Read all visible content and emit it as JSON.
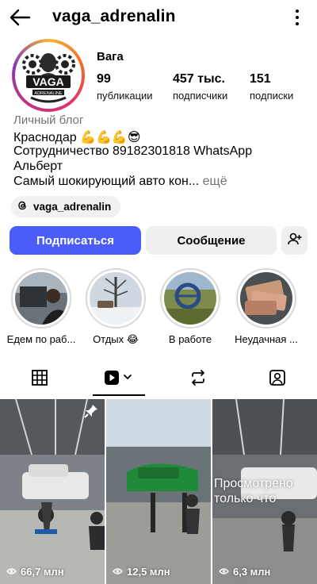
{
  "header": {
    "username": "vaga_adrenalin"
  },
  "profile": {
    "name": "Вага",
    "avatar_text": "VAGA",
    "avatar_subtext": "ADRENALINE",
    "stats": [
      {
        "value": "99",
        "label": "публикации"
      },
      {
        "value": "457 тыс.",
        "label": "подписчики"
      },
      {
        "value": "151",
        "label": "подписки"
      }
    ],
    "category": "Личный блог",
    "bio": [
      "Краснодар 💪💪💪😎",
      "Сотрудничество 89182301818 WhatsApp",
      "Альберт",
      "Самый шокирующий авто кон..."
    ],
    "more_label": "ещё",
    "threads_handle": "vaga_adrenalin"
  },
  "actions": {
    "follow_label": "Подписаться",
    "message_label": "Сообщение"
  },
  "highlights": [
    {
      "label": "Едем по раб..."
    },
    {
      "label": "Отдых 😂"
    },
    {
      "label": "В работе"
    },
    {
      "label": "Неудачная ..."
    }
  ],
  "tabs": [
    "grid",
    "reels",
    "reposts",
    "tagged"
  ],
  "active_tab": "reels",
  "posts": [
    {
      "views": "66,7 млн",
      "pinned": true
    },
    {
      "views": "12,5 млн",
      "pinned": false
    },
    {
      "views": "6,3 млн",
      "pinned": false,
      "overlay": "Просмотрено только что"
    }
  ],
  "colors": {
    "accent": "#4a5df9",
    "button_gray": "#efeff1",
    "muted_text": "#737373"
  }
}
